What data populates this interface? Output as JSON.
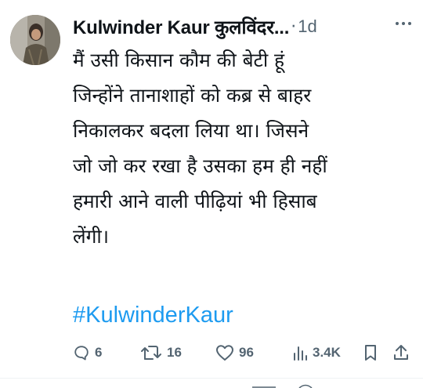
{
  "tweet": {
    "author_name": "Kulwinder Kaur कुलविंदर...",
    "separator": "·",
    "timestamp": "1d",
    "text_lines": [
      "मैं उसी किसान कौम की बेटी हूं",
      "जिन्होंने तानाशाहों को कब्र से बाहर",
      "निकालकर बदला लिया था। जिसने",
      "जो जो कर रखा है उसका हम ही नहीं",
      "हमारी आने वाली पीढ़ियां भी हिसाब",
      "लेंगी।"
    ],
    "hashtag": "#KulwinderKaur"
  },
  "actions": {
    "replies": "6",
    "retweets": "16",
    "likes": "96",
    "views": "3.4K"
  },
  "icons": {
    "avatar": "avatar",
    "more": "more-icon",
    "reply": "reply-icon",
    "retweet": "retweet-icon",
    "like": "heart-icon",
    "views": "views-icon",
    "bookmark": "bookmark-icon",
    "share": "share-icon"
  },
  "colors": {
    "text": "#0f1419",
    "secondary": "#536471",
    "link": "#1d9bf0"
  }
}
